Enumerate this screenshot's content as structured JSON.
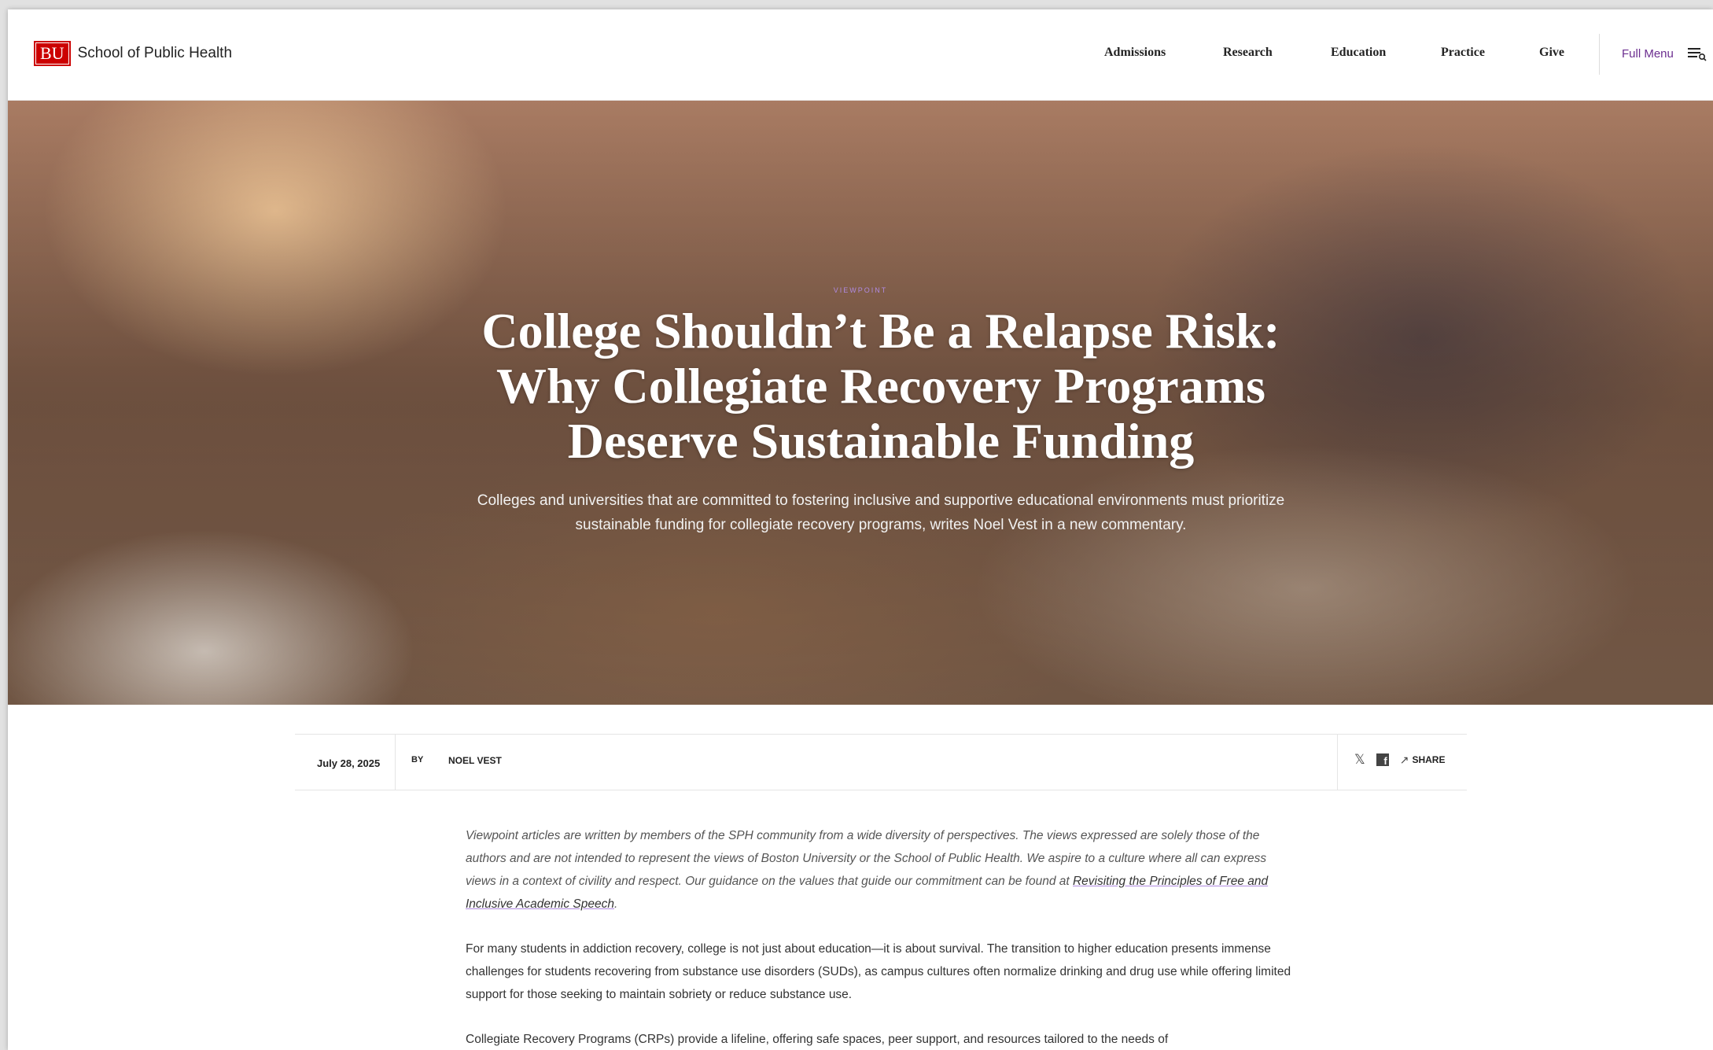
{
  "header": {
    "logo_mark": "BU",
    "school_name": "School of Public Health",
    "nav": [
      "Admissions",
      "Research",
      "Education",
      "Practice",
      "Give"
    ],
    "full_menu_label": "Full Menu",
    "menu_icon": "hamburger-search-icon"
  },
  "hero": {
    "eyebrow": "VIEWPOINT",
    "headline": "College Shouldn’t Be a Relapse Risk: Why Collegiate Recovery Programs Deserve Sustainable Funding",
    "dek": "Colleges and universities that are committed to fostering inclusive and supportive educational environments must prioritize sustainable funding for collegiate recovery programs, writes Noel Vest in a new commentary."
  },
  "meta": {
    "date": "July 28, 2025",
    "by_label": "BY",
    "author": "NOEL VEST",
    "share_label": "SHARE",
    "icons": [
      "x-icon",
      "facebook-icon",
      "share-icon"
    ]
  },
  "article": {
    "disclaimer_text": "Viewpoint articles are written by members of the SPH community from a wide diversity of perspectives. The views expressed are solely those of the authors and are not intended to represent the views of Boston University or the School of Public Health. We aspire to a culture where all can express views in a context of civility and respect. Our guidance on the values that guide our commitment can be found at ",
    "disclaimer_link": "Revisiting the Principles of Free and Inclusive Academic Speech",
    "disclaimer_end": ".",
    "paragraph_1": "For many students in addiction recovery, college is not just about education—it is about survival. The transition to higher education presents immense challenges for students recovering from substance use disorders (SUDs), as campus cultures often normalize drinking and drug use while offering limited support for those seeking to maintain sobriety or reduce substance use.",
    "paragraph_2": "Collegiate Recovery Programs (CRPs) provide a lifeline, offering safe spaces, peer support, and resources tailored to the needs of"
  },
  "colors": {
    "brand_red": "#cc0000",
    "accent_purple": "#6b2d8f",
    "eyebrow_purple": "#b08ae0"
  }
}
